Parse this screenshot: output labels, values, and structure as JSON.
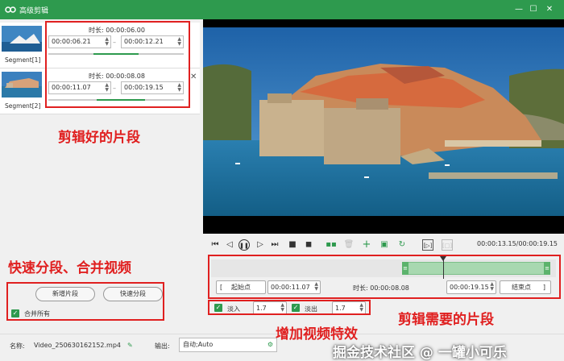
{
  "window": {
    "title": "高级剪辑"
  },
  "segments": [
    {
      "label": "Segment[1]",
      "duration_label": "时长: 00:00:06.00",
      "start": "00:00:06.21",
      "end": "00:00:12.21"
    },
    {
      "label": "Segment[2]",
      "duration_label": "时长: 00:00:08.08",
      "start": "00:00:11.07",
      "end": "00:00:19.15"
    }
  ],
  "left_actions": {
    "add_segment": "新增片段",
    "quick_split": "快速分段",
    "merge_all": "合并所有"
  },
  "player": {
    "timecode": "00:00:13.15/00:00:19.15"
  },
  "range": {
    "start_btn": "起始点",
    "start_value": "00:00:11.07",
    "duration_label": "时长: 00:00:08.08",
    "end_value": "00:00:19.15",
    "end_btn": "结束点"
  },
  "effects": {
    "fade_in_label": "淡入",
    "fade_in_value": "1.7",
    "fade_out_label": "淡出",
    "fade_out_value": "1.7"
  },
  "bottom": {
    "name_label": "名称:",
    "file_name": "Video_250630162152.mp4",
    "output_label": "输出:",
    "output_value": "自动;Auto"
  },
  "annotations": {
    "clipped_segments": "剪辑好的片段",
    "quick_split_merge": "快速分段、合并视频",
    "clip_needed_segment": "剪辑需要的片段",
    "add_video_effects": "增加视频特效"
  },
  "watermark": "掘金技术社区 @ 一罐小可乐",
  "colors": {
    "accent": "#2e9a4e",
    "annotation": "#e02020"
  }
}
